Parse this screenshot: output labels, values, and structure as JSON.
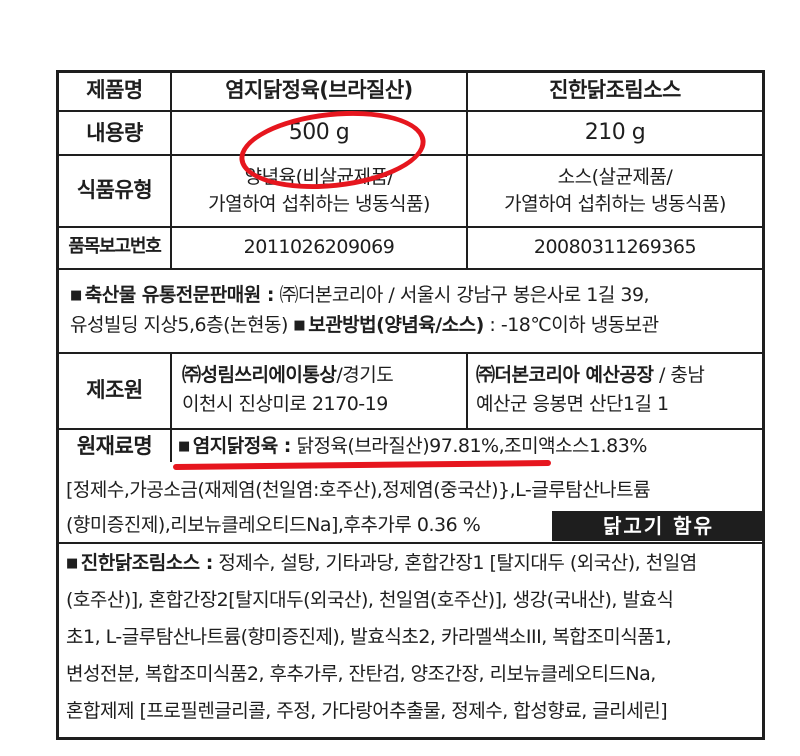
{
  "header": {
    "label": "제품명",
    "product1": "염지닭정육(브라질산)",
    "product2": "진한닭조림소스"
  },
  "rows": {
    "content_label": "내용량",
    "content1": "500 g",
    "content2": "210 g",
    "type_label": "식품유형",
    "type1_line1": "양념육(비살균제품/",
    "type1_line2": "가열하여 섭취하는 냉동식품)",
    "type2_line1": "소스(살균제품/",
    "type2_line2": "가열하여 섭취하는 냉동식품)",
    "report_label": "품목보고번호",
    "report1": "2011026209069",
    "report2": "20080311269365"
  },
  "distributor": {
    "line1_bold": "축산물 유통전문판매원 :",
    "line1_text": " ㈜더본코리아 / 서울시 강남구 봉은사로 1길 39,",
    "line2_text": "유성빌딩 지상5,6층(논현동) ",
    "line2_bold": "보관방법(양념육/소스)",
    "line2_tail": " : -18℃이하 냉동보관"
  },
  "manufacturer": {
    "label": "제조원",
    "m1_bold": "㈜성림쓰리에이통상",
    "m1_rest": "/경기도",
    "m1_line2": "이천시 진상미로 2170-19",
    "m2_bold": "㈜더본코리아 예산공장",
    "m2_rest": " / 충남",
    "m2_line2": "예산군 응봉면 산단1길 1"
  },
  "ingredients": {
    "label": "원재료명",
    "line1_bold": "염지닭정육 :",
    "line1_text": " 닭정육(브라질산)97.81%,조미액소스1.83%",
    "line2": "[정제수,가공소금(재제염(천일염:호주산),정제염(중국산)},L-글루탐산나트륨",
    "line3": "(향미증진제),리보뉴클레오티드Na],후추가루 0.36 %",
    "stamp": "닭고기 함유"
  },
  "sauce": {
    "bold": "진한닭조림소스 :",
    "line1": " 정제수, 설탕, 기타과당, 혼합간장1 [탈지대두 (외국산), 천일염",
    "line2": "(호주산)], 혼합간장2[탈지대두(외국산), 천일염(호주산)], 생강(국내산), 발효식",
    "line3": "초1, L-글루탐산나트륨(향미증진제), 발효식초2, 카라멜색소III, 복합조미식품1,",
    "line4": "변성전분, 복합조미식품2, 후추가루, 잔탄검, 양조간장, 리보뉴클레오티드Na,",
    "line5": "혼합제제 [프로필렌글리콜, 주정, 가다랑어추출물, 정제수, 합성향료, 글리세린]"
  },
  "colors": {
    "ink": "#1e1e1e",
    "highlight": "#e6161e"
  }
}
